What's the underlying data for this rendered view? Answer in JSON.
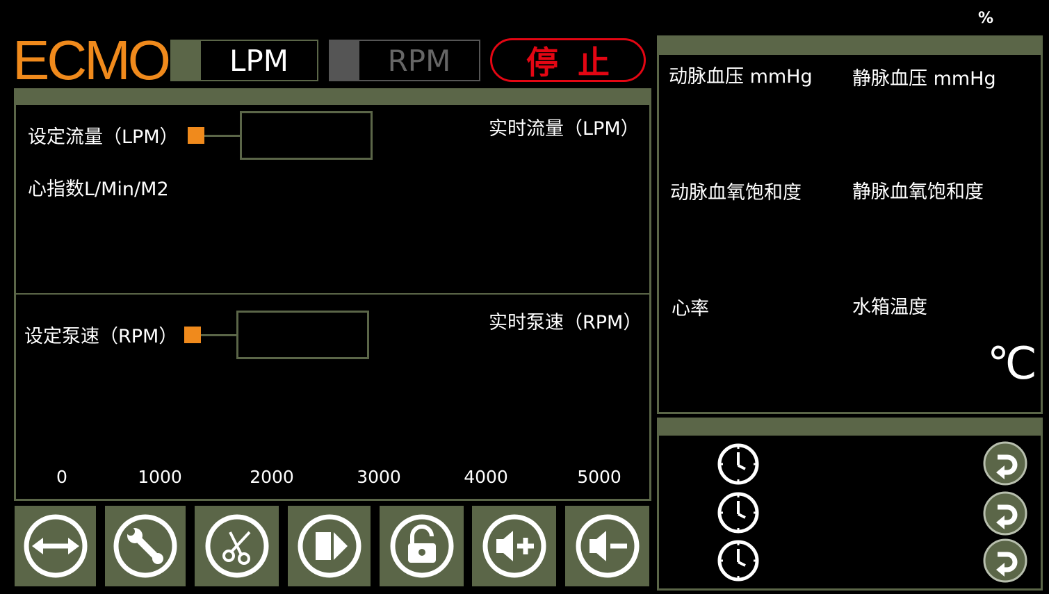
{
  "header": {
    "logo": "ECMO",
    "mode_lpm": "LPM",
    "mode_rpm": "RPM",
    "stop": "停止",
    "percent": "%"
  },
  "flow_panel": {
    "set_flow_label": "设定流量（LPM）",
    "realtime_flow_label": "实时流量（LPM）",
    "cardiac_index_label": "心指数L/Min/M2",
    "set_speed_label": "设定泵速（RPM）",
    "realtime_speed_label": "实时泵速（RPM）",
    "speed_scale": [
      "0",
      "1000",
      "2000",
      "3000",
      "4000",
      "5000"
    ]
  },
  "vitals": {
    "arterial_pressure": "动脉血压 mmHg",
    "venous_pressure": "静脉血压 mmHg",
    "arterial_sat": "动脉血氧饱和度",
    "venous_sat": "静脉血氧饱和度",
    "heart_rate": "心率",
    "tank_temp": "水箱温度",
    "temp_unit": "℃"
  },
  "toolbar": {
    "buttons": [
      "swap-arrows-icon",
      "wrench-icon",
      "scissors-icon",
      "play-next-icon",
      "unlock-icon",
      "volume-up-icon",
      "volume-down-icon"
    ]
  },
  "timers": {
    "rows": [
      "clock-icon",
      "clock-icon",
      "clock-icon"
    ],
    "reset_icons": [
      "undo-icon",
      "undo-icon",
      "undo-icon"
    ]
  },
  "colors": {
    "accent": "#f08a1c",
    "panel_green": "#5b6648",
    "stop_red": "#e30613"
  }
}
